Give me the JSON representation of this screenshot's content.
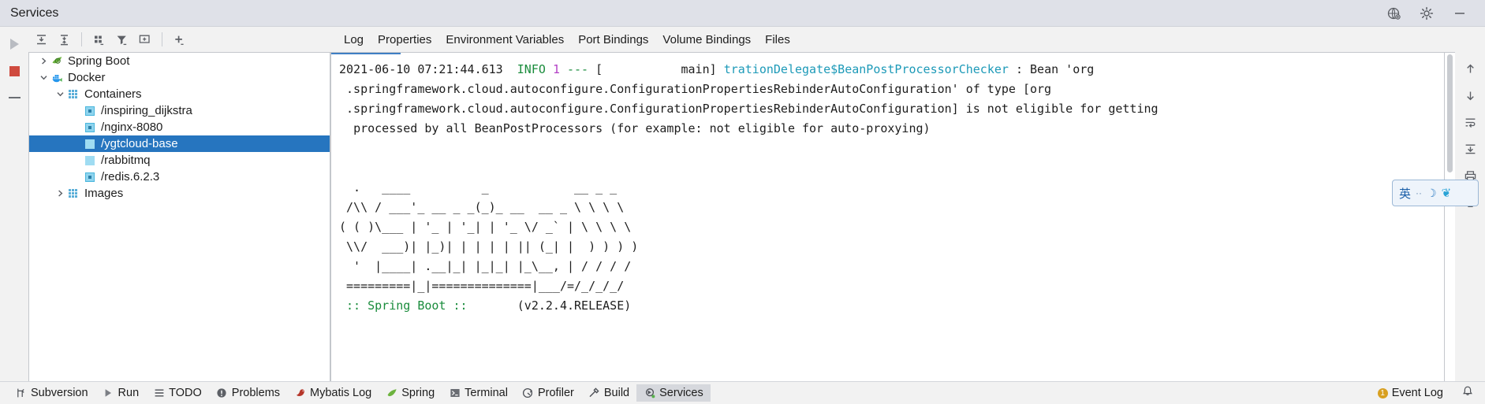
{
  "titlebar": {
    "title": "Services",
    "icons": [
      {
        "name": "globe-settings-icon",
        "glyph": "globe"
      },
      {
        "name": "gear-icon",
        "glyph": "gear"
      },
      {
        "name": "minimize-icon",
        "glyph": "minimize"
      }
    ]
  },
  "runstrip": {
    "run_label": "Run",
    "stop_label": "Stop",
    "collapse_label": "Collapse"
  },
  "left_toolbar": {
    "buttons": [
      {
        "name": "run-button",
        "icon": "play-icon",
        "tooltip": "Run"
      },
      {
        "name": "expand-all-button",
        "icon": "expand-all-icon",
        "tooltip": "Expand All"
      },
      {
        "name": "collapse-all-button",
        "icon": "collapse-all-icon",
        "tooltip": "Collapse All"
      },
      {
        "name": "group-button",
        "icon": "group-icon",
        "tooltip": "Group"
      },
      {
        "name": "filter-button",
        "icon": "filter-icon",
        "tooltip": "Filter"
      },
      {
        "name": "add-tab-button",
        "icon": "add-frame-icon",
        "tooltip": "Add Tab"
      },
      {
        "name": "add-service-button",
        "icon": "plus-icon",
        "tooltip": "Add Service"
      }
    ]
  },
  "tree": {
    "items": [
      {
        "label": "Spring Boot",
        "indent": 0,
        "twisty": "right",
        "icon": "spring-boot-icon",
        "selected": false
      },
      {
        "label": "Docker",
        "indent": 0,
        "twisty": "down",
        "icon": "docker-icon",
        "selected": false
      },
      {
        "label": "Containers",
        "indent": 1,
        "twisty": "down",
        "icon": "containers-icon",
        "selected": false
      },
      {
        "label": "/inspiring_dijkstra",
        "indent": 2,
        "twisty": "none",
        "icon": "container-stopped-icon",
        "selected": false
      },
      {
        "label": "/nginx-8080",
        "indent": 2,
        "twisty": "none",
        "icon": "container-stopped-icon",
        "selected": false
      },
      {
        "label": "/ygtcloud-base",
        "indent": 2,
        "twisty": "none",
        "icon": "container-running-icon",
        "selected": true
      },
      {
        "label": "/rabbitmq",
        "indent": 2,
        "twisty": "none",
        "icon": "container-running-icon",
        "selected": false
      },
      {
        "label": "/redis.6.2.3",
        "indent": 2,
        "twisty": "none",
        "icon": "container-stopped-icon",
        "selected": false
      },
      {
        "label": "Images",
        "indent": 1,
        "twisty": "right",
        "icon": "containers-icon",
        "selected": false
      }
    ]
  },
  "tabs": {
    "items": [
      {
        "label": "Log",
        "active": true
      },
      {
        "label": "Properties",
        "active": false
      },
      {
        "label": "Environment Variables",
        "active": false
      },
      {
        "label": "Port Bindings",
        "active": false
      },
      {
        "label": "Volume Bindings",
        "active": false
      },
      {
        "label": "Files",
        "active": false
      }
    ]
  },
  "console": {
    "log_entry": {
      "timestamp": "2021-06-10 07:21:44.613",
      "level": "INFO",
      "pid": "1",
      "dashes": "---",
      "thread": "[           main]",
      "logger": "trationDelegate$BeanPostProcessorChecker",
      "separator": " : ",
      "message_line1": "Bean 'org",
      "message_line2": ".springframework.cloud.autoconfigure.ConfigurationPropertiesRebinderAutoConfiguration' of type [org",
      "message_line3": ".springframework.cloud.autoconfigure.ConfigurationPropertiesRebinderAutoConfiguration] is not eligible for getting",
      "message_line4": "processed by all BeanPostProcessors (for example: not eligible for auto-proxying)"
    },
    "banner": {
      "line1": "  .   ____          _            __ _ _",
      "line2": " /\\\\ / ___'_ __ _ _(_)_ __  __ _ \\ \\ \\ \\",
      "line3": "( ( )\\___ | '_ | '_| | '_ \\/ _` | \\ \\ \\ \\",
      "line4": " \\\\/  ___)| |_)| | | | | || (_| |  ) ) ) )",
      "line5": "  '  |____| .__|_| |_|_| |_\\__, | / / / /",
      "line6": " =========|_|==============|___/=/_/_/_/"
    },
    "spring_line": ":: Spring Boot ::",
    "spring_version": "(v2.2.4.RELEASE)"
  },
  "console_side": {
    "buttons": [
      {
        "name": "scroll-up-button",
        "icon": "arrow-up-icon"
      },
      {
        "name": "scroll-down-button",
        "icon": "arrow-down-icon"
      },
      {
        "name": "soft-wrap-button",
        "icon": "soft-wrap-icon"
      },
      {
        "name": "scroll-to-end-button",
        "icon": "scroll-end-icon"
      },
      {
        "name": "print-button",
        "icon": "printer-icon"
      },
      {
        "name": "clear-all-button",
        "icon": "trash-icon"
      }
    ]
  },
  "ime": {
    "mode": "英",
    "dot": "··",
    "moon": "☽",
    "bird": "❦"
  },
  "statusbar": {
    "items": [
      {
        "label": "Subversion",
        "icon": "branch-icon",
        "active": false
      },
      {
        "label": "Run",
        "icon": "play-icon",
        "active": false
      },
      {
        "label": "TODO",
        "icon": "list-icon",
        "active": false
      },
      {
        "label": "Problems",
        "icon": "error-icon",
        "active": false
      },
      {
        "label": "Mybatis Log",
        "icon": "bird-icon",
        "active": false
      },
      {
        "label": "Spring",
        "icon": "leaf-icon",
        "active": false
      },
      {
        "label": "Terminal",
        "icon": "terminal-icon",
        "active": false
      },
      {
        "label": "Profiler",
        "icon": "profiler-icon",
        "active": false
      },
      {
        "label": "Build",
        "icon": "hammer-icon",
        "active": false
      },
      {
        "label": "Services",
        "icon": "services-icon",
        "active": true
      }
    ],
    "event_log": "Event Log",
    "event_count": "1"
  },
  "colors": {
    "selection": "#2675bf",
    "info_green": "#1a8c3c",
    "pid_magenta": "#b341c6",
    "logger_cyan": "#1d9ab8",
    "tab_indicator": "#3f7fc4",
    "stop_red": "#cf4a3f"
  }
}
